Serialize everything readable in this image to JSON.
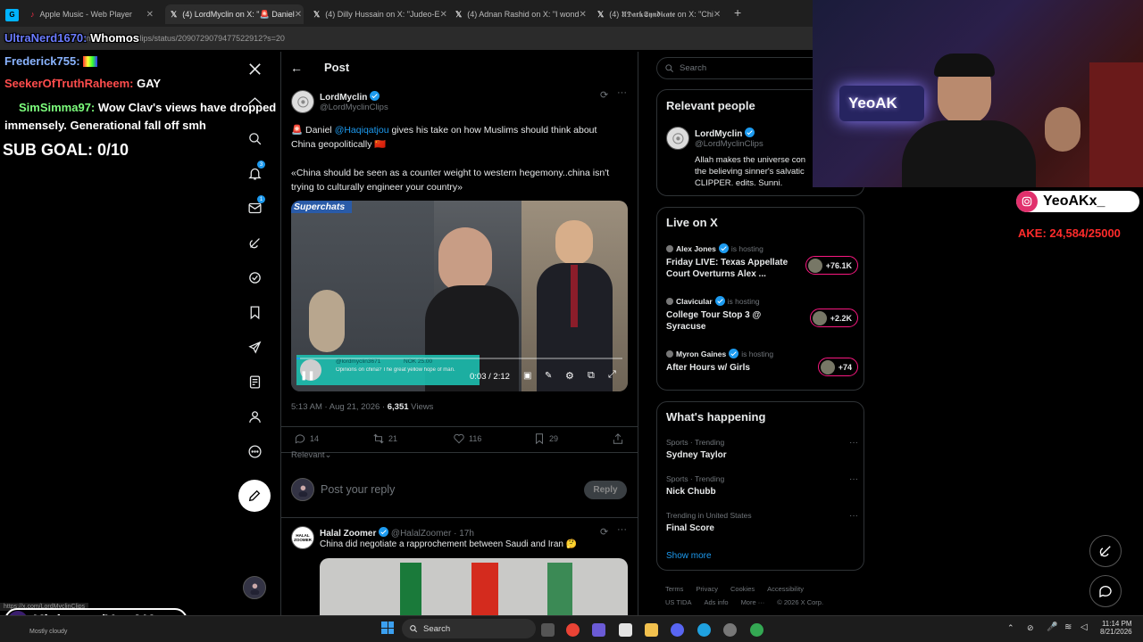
{
  "browser": {
    "tabs": [
      {
        "fav": "𝕏",
        "label": "Apple Music - Web Player"
      },
      {
        "fav": "𝕏",
        "label": "(4) LordMyclin on X: \"🚨 Daniel"
      },
      {
        "fav": "𝕏",
        "label": "(4) Dilly Hussain on X: \"Judeo-E"
      },
      {
        "fav": "𝕏",
        "label": "(4) Adnan Rashid on X: \"I wond"
      },
      {
        "fav": "𝕏",
        "label": "(4) 𝖀𝕯𝖆𝖗𝖐𝕾𝖞𝖓𝖉𝖎𝖈𝖆𝖙𝖊 on X: \"Chi"
      }
    ],
    "new_tab": "+",
    "url": "x.com/LordMyclinClips/status/2090729079477522912?s=20",
    "status_url": "https://x.com/LordMyclinClips"
  },
  "stream_overlay": {
    "chat": [
      {
        "user": "UltraNerd1670:",
        "msg": "Whomos",
        "color": "#6b7cff"
      },
      {
        "user": "Frederick755:",
        "msg": "",
        "color": "#8ab4ff"
      },
      {
        "user": "SeekerOfTruthRaheem:",
        "msg": "GAY",
        "color": "#ff4d4d"
      },
      {
        "user": "SimSimma97:",
        "msg": "Wow Clav's views have dropped immensely. Generational fall off smh",
        "color": "#7dff7d"
      }
    ],
    "sub_goal": "SUB GOAL: 0/10",
    "instagram": "YeoAKx_",
    "ake_goal": "AKE: 24,584/25000",
    "kick": "Kick.com/YeoAK",
    "webcam_sign": "YeoAK",
    "weather": "Mostly cloudy"
  },
  "nav": {
    "items": [
      "x-logo",
      "home",
      "explore",
      "notifications",
      "messages",
      "grok",
      "verified",
      "bookmarks",
      "jobs",
      "lists",
      "profile",
      "more"
    ],
    "notif_count": "3",
    "msg_count": "1"
  },
  "post": {
    "header_title": "Post",
    "author_name": "LordMyclin",
    "author_handle": "@LordMyclinClips",
    "text_prefix": "🚨 Daniel ",
    "mention": "@Haqiqatjou",
    "text_suffix": " gives his take on how Muslims should think about China geopolitically 🇨🇳",
    "quote": "«China should be seen as a counter weight to western hegemony..china isn't trying to culturally engineer your country»",
    "video_label": "Superchats",
    "superchat_user": "@lordmyclin3671",
    "superchat_amount": "NOK 25.00",
    "superchat_text": "Opinions on china? The great yellow hope of man.",
    "video_time": "0:03 / 2:12",
    "time": "5:13 AM · Aug 21, 2026 · ",
    "views_count": "6,351",
    "views_label": " Views",
    "replies": "14",
    "reposts": "21",
    "likes": "116",
    "bookmarks": "29",
    "sort": "Relevant",
    "reply_placeholder": "Post your reply",
    "reply_button": "Reply"
  },
  "reply": {
    "name": "Halal Zoomer",
    "handle": "@HalalZoomer · 17h",
    "text": "China did negotiate a rapprochement between Saudi and Iran 🤔",
    "avatar_text": "HALAL ZOOMER"
  },
  "sidebar": {
    "search_placeholder": "Search",
    "relevant_title": "Relevant people",
    "relevant_name": "LordMyclin",
    "relevant_handle": "@LordMyclinClips",
    "relevant_bio": "Allah makes the universe con the believing sinner's salvatic CLIPPER. edits. Sunni.",
    "live_title": "Live on X",
    "live": [
      {
        "host": "Alex Jones",
        "status": "is hosting",
        "title": "Friday LIVE: Texas Appellate Court Overturns Alex ...",
        "count": "+76.1K"
      },
      {
        "host": "Clavicular",
        "status": "is hosting",
        "title": "College Tour Stop 3 @ Syracuse",
        "count": "+2.2K"
      },
      {
        "host": "Myron Gaines",
        "status": "is hosting",
        "title": "After Hours w/ Girls",
        "count": "+74"
      }
    ],
    "happening_title": "What's happening",
    "trends": [
      {
        "cat": "Sports · Trending",
        "name": "Sydney Taylor"
      },
      {
        "cat": "Sports · Trending",
        "name": "Nick Chubb"
      },
      {
        "cat": "Trending in United States",
        "name": "Final Score"
      }
    ],
    "show_more": "Show more",
    "footer_line1": [
      "Terms",
      "Privacy",
      "Cookies",
      "Accessibility"
    ],
    "footer_line2": [
      "US TIDA",
      "Ads info",
      "More ···",
      "© 2026 X Corp."
    ]
  },
  "taskbar": {
    "search": "Search",
    "time": "11:14 PM",
    "date": "8/21/2026"
  }
}
